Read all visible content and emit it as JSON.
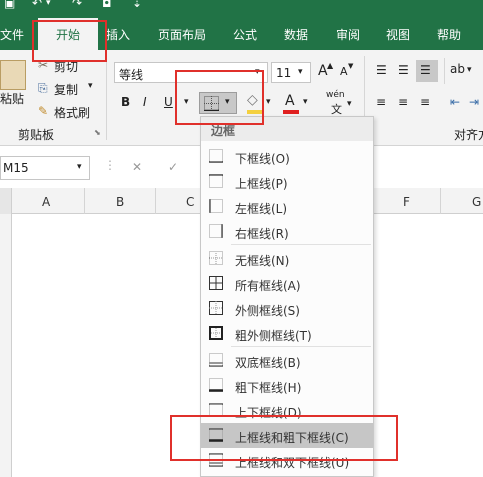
{
  "quick_access": {
    "save_icon": "save-icon",
    "undo_icon": "undo-icon",
    "redo_icon": "redo-icon",
    "camera_icon": "camera-icon"
  },
  "tabs": [
    {
      "label": "文件",
      "active": false
    },
    {
      "label": "开始",
      "active": true
    },
    {
      "label": "插入",
      "active": false
    },
    {
      "label": "页面布局",
      "active": false
    },
    {
      "label": "公式",
      "active": false
    },
    {
      "label": "数据",
      "active": false
    },
    {
      "label": "审阅",
      "active": false
    },
    {
      "label": "视图",
      "active": false
    },
    {
      "label": "帮助",
      "active": false
    }
  ],
  "clipboard": {
    "paste_label": "粘贴",
    "cut_label": "剪切",
    "copy_label": "复制",
    "format_painter_label": "格式刷",
    "group_label": "剪贴板"
  },
  "font": {
    "name": "等线",
    "size": "11",
    "bold": "B",
    "italic": "I",
    "underline": "U",
    "grow_glyph": "A",
    "shrink_glyph": "A",
    "font_color_glyph": "A",
    "phonetic_glyph": "wén",
    "phonetic_sub": "文"
  },
  "alignment": {
    "group_label": "对齐方"
  },
  "formula_bar": {
    "name_box": "M15",
    "cancel_glyph": "✕",
    "enter_glyph": "✓"
  },
  "columns": [
    "A",
    "B",
    "C",
    "F",
    "G"
  ],
  "border_menu": {
    "header": "边框",
    "items": [
      {
        "label": "下框线(O)",
        "icon": "border-bottom-icon"
      },
      {
        "label": "上框线(P)",
        "icon": "border-top-icon"
      },
      {
        "label": "左框线(L)",
        "icon": "border-left-icon"
      },
      {
        "label": "右框线(R)",
        "icon": "border-right-icon"
      },
      {
        "label": "无框线(N)",
        "icon": "border-none-icon"
      },
      {
        "label": "所有框线(A)",
        "icon": "border-all-icon"
      },
      {
        "label": "外侧框线(S)",
        "icon": "border-outside-icon"
      },
      {
        "label": "粗外侧框线(T)",
        "icon": "border-thick-outside-icon"
      },
      {
        "label": "双底框线(B)",
        "icon": "border-double-bottom-icon"
      },
      {
        "label": "粗下框线(H)",
        "icon": "border-thick-bottom-icon"
      },
      {
        "label": "上下框线(D)",
        "icon": "border-top-bottom-icon"
      },
      {
        "label": "上框线和粗下框线(C)",
        "icon": "border-top-thick-bottom-icon",
        "highlighted": true
      },
      {
        "label": "上框线和双下框线(U)",
        "icon": "border-top-double-bottom-icon"
      }
    ]
  },
  "colors": {
    "accent": "#217346",
    "annotation": "#e0302b",
    "highlight_bar": "#f4d03f",
    "font_red": "#e02020"
  }
}
